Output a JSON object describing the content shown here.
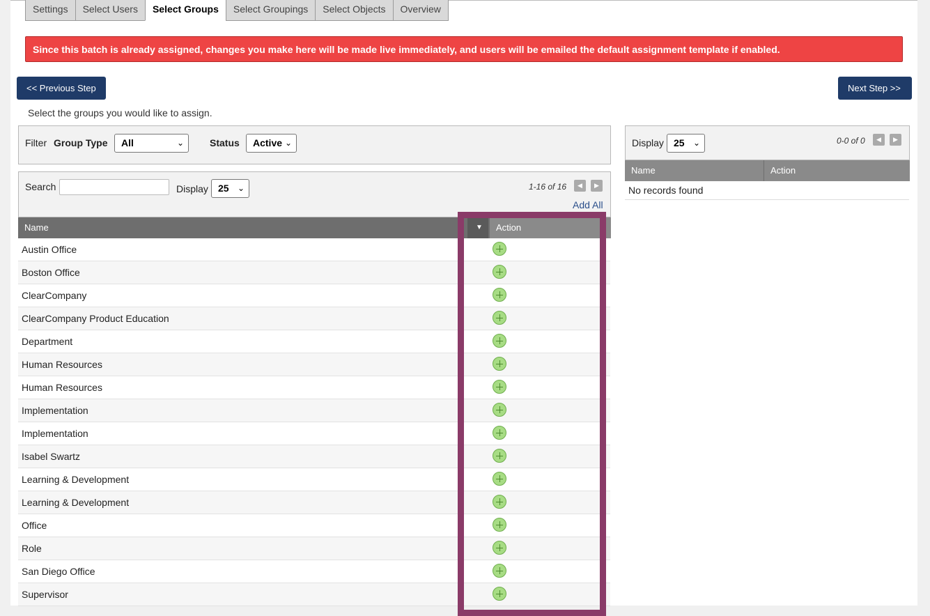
{
  "tabs": [
    "Settings",
    "Select Users",
    "Select Groups",
    "Select Groupings",
    "Select Objects",
    "Overview"
  ],
  "active_tab": "Select Groups",
  "alert": "Since this batch is already assigned, changes you make here will be made live immediately, and users will be emailed the default assignment template if enabled.",
  "buttons": {
    "prev": "<< Previous Step",
    "next": "Next Step >>"
  },
  "instructions": "Select the groups you would like to assign.",
  "filter": {
    "label": "Filter",
    "group_type_label": "Group Type",
    "group_type_value": "All",
    "status_label": "Status",
    "status_value": "Active"
  },
  "left": {
    "search_label": "Search",
    "search_value": "",
    "display_label": "Display",
    "display_value": "25",
    "pager": "1-16 of 16",
    "add_all": "Add All",
    "col_name": "Name",
    "col_action": "Action",
    "sort_glyph": "▼",
    "rows": [
      "Austin Office",
      "Boston Office",
      "ClearCompany",
      "ClearCompany Product Education",
      "Department",
      "Human Resources",
      "Human Resources",
      "Implementation",
      "Implementation",
      "Isabel Swartz",
      "Learning & Development",
      "Learning & Development",
      "Office",
      "Role",
      "San Diego Office",
      "Supervisor"
    ]
  },
  "right": {
    "display_label": "Display",
    "display_value": "25",
    "pager": "0-0 of 0",
    "col_name": "Name",
    "col_action": "Action",
    "empty": "No records found"
  },
  "colors": {
    "accent": "#1f3b68",
    "alert": "#ee4444",
    "highlight": "#8a3b68",
    "add": "#a7dc84"
  },
  "icons": {
    "prev_page": "triangle-left-icon",
    "next_page": "triangle-right-icon",
    "add_row": "plus-circle-icon",
    "dropdown": "chevron-down-icon"
  }
}
